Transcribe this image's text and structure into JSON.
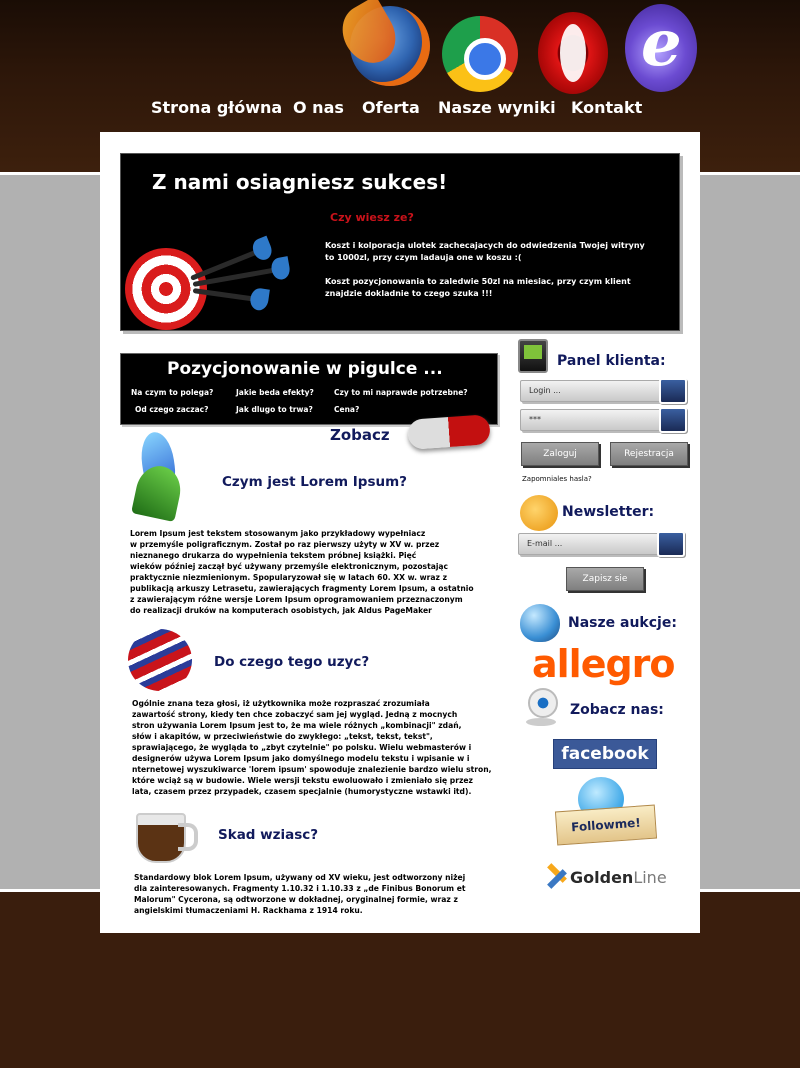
{
  "nav": [
    "Strona główna",
    "O nas",
    "Oferta",
    "Nasze wyniki",
    "Kontakt"
  ],
  "browser_icons": [
    "firefox-icon",
    "chrome-icon",
    "opera-icon",
    "ie-icon"
  ],
  "hero": {
    "title": "Z nami osiagniesz sukces!",
    "question": "Czy wiesz ze?",
    "line1": "Koszt i kolporacja ulotek zachecajacych do odwiedzenia Twojej witryny",
    "line2": "to 1000zl, przy czym ladauja one w koszu :(",
    "line3": "Koszt pozycjonowania to zaledwie 50zl na miesiac, przy czym klient",
    "line4": "znajdzie dokladnie to czego szuka !!!"
  },
  "poz": {
    "title": "Pozycjonowanie w pigulce ...",
    "links": [
      "Na czym to polega?",
      "Jakie beda efekty?",
      "Czy to mi naprawde potrzebne?",
      "Od czego zaczac?",
      "Jak dlugo to trwa?",
      "Cena?"
    ],
    "cta": "Zobacz"
  },
  "articles": [
    {
      "title": "Czym jest Lorem Ipsum?",
      "lines": [
        "Lorem Ipsum jest tekstem stosowanym jako przykładowy wypełniacz",
        "w przemyśle poligraficznym. Został po raz pierwszy użyty w XV w. przez",
        "nieznanego drukarza do wypełnienia tekstem próbnej książki. Pięć",
        "wieków później zaczął być używany przemyśle elektronicznym, pozostając",
        "praktycznie niezmienionym. Spopularyzował się w latach 60. XX w. wraz z",
        "publikacją arkuszy Letrasetu, zawierających fragmenty Lorem Ipsum, a ostatnio",
        " z zawierającym różne wersje Lorem Ipsum oprogramowaniem przeznaczonym",
        "do realizacji druków na komputerach osobistych, jak Aldus PageMaker"
      ]
    },
    {
      "title": "Do czego tego uzyc?",
      "lines": [
        "Ogólnie znana teza głosi, iż użytkownika może rozpraszać zrozumiała",
        "zawartość strony, kiedy ten chce zobaczyć sam jej wygląd. Jedną z mocnych",
        "stron używania Lorem Ipsum jest to, że ma wiele różnych „kombinacji\" zdań,",
        " słów i akapitów, w przeciwieństwie do zwykłego: „tekst, tekst, tekst\",",
        "sprawiającego, że wygląda to „zbyt czytelnie\" po polsku. Wielu webmasterów i",
        "designerów używa Lorem Ipsum jako domyślnego modelu tekstu i wpisanie w i",
        "nternetowej wyszukiwarce 'lorem ipsum' spowoduje znalezienie bardzo wielu stron,",
        " które wciąż są w budowie. Wiele wersji tekstu ewoluowało i zmieniało się przez",
        "lata, czasem przez przypadek, czasem specjalnie (humorystyczne wstawki itd)."
      ]
    },
    {
      "title": "Skad wziasc?",
      "lines": [
        "Standardowy blok Lorem Ipsum, używany od XV wieku, jest odtworzony niżej",
        "dla zainteresowanych. Fragmenty 1.10.32 i 1.10.33 z „de Finibus Bonorum et",
        " Malorum\" Cycerona, są odtworzone w dokładnej, oryginalnej formie, wraz z",
        "angielskimi tłumaczeniami H. Rackhama z 1914 roku."
      ]
    }
  ],
  "sidebar": {
    "panel_title": "Panel klienta:",
    "login_value": "Login ...",
    "password_value": "***",
    "login_button": "Zaloguj",
    "register_button": "Rejestracja",
    "forgot": "Zapomniales hasla?",
    "newsletter_title": "Newsletter:",
    "email_value": "E-mail ...",
    "subscribe_button": "Zapisz sie",
    "auctions_title": "Nasze aukcje:",
    "allegro": "allegro",
    "see_us_title": "Zobacz nas:",
    "facebook": "facebook",
    "followme": "Followme!",
    "golden_a": "Golden",
    "golden_b": "Line"
  }
}
